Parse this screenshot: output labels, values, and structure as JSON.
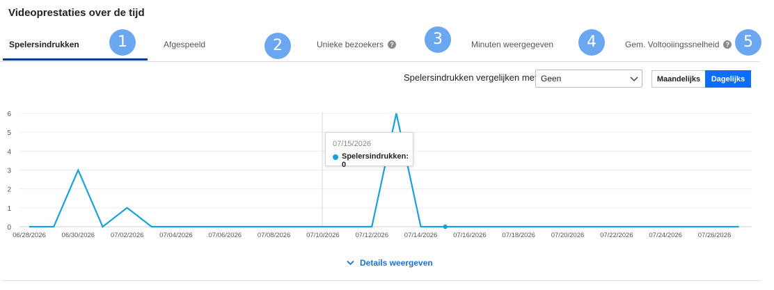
{
  "page": {
    "title": "Videoprestaties over de tijd"
  },
  "tabs": [
    {
      "label": "Spelersindrukken",
      "active": true,
      "help": false
    },
    {
      "label": "Afgespeeld",
      "active": false,
      "help": false
    },
    {
      "label": "Unieke bezoekers",
      "active": false,
      "help": true
    },
    {
      "label": "Minuten weergegeven",
      "active": false,
      "help": false
    },
    {
      "label": "Gem. Voltooiingssnelheid",
      "active": false,
      "help": true
    }
  ],
  "steps": [
    "1",
    "2",
    "3",
    "4",
    "5"
  ],
  "help_glyph": "?",
  "compare": {
    "label": "Spelersindrukken vergelijken met",
    "selected": "Geen"
  },
  "period": {
    "monthly": "Maandelijks",
    "daily": "Dagelijks",
    "selected": "Dagelijks"
  },
  "tooltip": {
    "date": "07/15/2026",
    "label": "Spelersindrukken: 0"
  },
  "details_link": "Details weergeven",
  "colors": {
    "line": "#1aa0d8",
    "accent": "#0d6efd",
    "step_badge": "#6aa7f0",
    "tab_underline": "#0b3d91"
  },
  "chart_data": {
    "type": "line",
    "x": [
      "06/28/2026",
      "06/29/2026",
      "06/30/2026",
      "07/01/2026",
      "07/02/2026",
      "07/03/2026",
      "07/04/2026",
      "07/05/2026",
      "07/06/2026",
      "07/07/2026",
      "07/08/2026",
      "07/09/2026",
      "07/10/2026",
      "07/11/2026",
      "07/12/2026",
      "07/13/2026",
      "07/14/2026",
      "07/15/2026",
      "07/16/2026",
      "07/17/2026",
      "07/18/2026",
      "07/19/2026",
      "07/20/2026",
      "07/21/2026",
      "07/22/2026",
      "07/23/2026",
      "07/24/2026",
      "07/25/2026",
      "07/26/2026",
      "07/27/2026"
    ],
    "series": [
      {
        "values": [
          0,
          0,
          3,
          0,
          1,
          0,
          0,
          0,
          0,
          0,
          0,
          0,
          0,
          0,
          0,
          6,
          0,
          0,
          0,
          0,
          0,
          0,
          0,
          0,
          0,
          0,
          0,
          0,
          0,
          0
        ]
      }
    ],
    "xtick_labels": [
      "06/28/2026",
      "06/30/2026",
      "07/02/2026",
      "07/04/2026",
      "07/06/2026",
      "07/08/2026",
      "07/10/2026",
      "07/12/2026",
      "07/14/2026",
      "07/16/2026",
      "07/18/2026",
      "07/20/2026",
      "07/22/2026",
      "07/24/2026",
      "07/26/2026"
    ],
    "yticks": [
      0,
      1,
      2,
      3,
      4,
      5,
      6
    ],
    "ylim": [
      0,
      6
    ],
    "hover_index": 17,
    "grid": true,
    "title": "",
    "xlabel": "",
    "ylabel": ""
  }
}
